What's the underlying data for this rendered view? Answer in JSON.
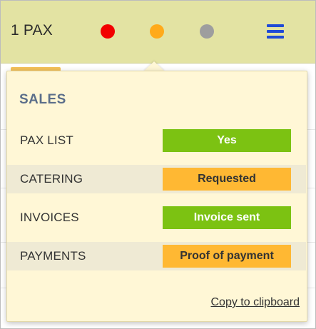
{
  "header": {
    "pax_label": "1 PAX",
    "indicators": [
      {
        "icon": "red-status-dot-icon",
        "color": "#f20000"
      },
      {
        "icon": "orange-status-dot-icon",
        "color": "#ffaa1a"
      },
      {
        "icon": "grey-status-dot-icon",
        "color": "#9e9e9e"
      }
    ],
    "menu_icon": "hamburger-menu-icon",
    "menu_color": "#1f4ad6",
    "background": "#e3e3a3"
  },
  "popover": {
    "section_title": "SALES",
    "rows": [
      {
        "label": "PAX LIST",
        "status": "Yes",
        "status_color": "#7cc212",
        "text_color": "#ffffff"
      },
      {
        "label": "CATERING",
        "status": "Requested",
        "status_color": "#ffb833",
        "text_color": "#333333"
      },
      {
        "label": "INVOICES",
        "status": "Invoice sent",
        "status_color": "#7cc212",
        "text_color": "#ffffff"
      },
      {
        "label": "PAYMENTS",
        "status": "Proof of payment",
        "status_color": "#ffb833",
        "text_color": "#333333"
      }
    ],
    "copy_link": "Copy to clipboard"
  }
}
